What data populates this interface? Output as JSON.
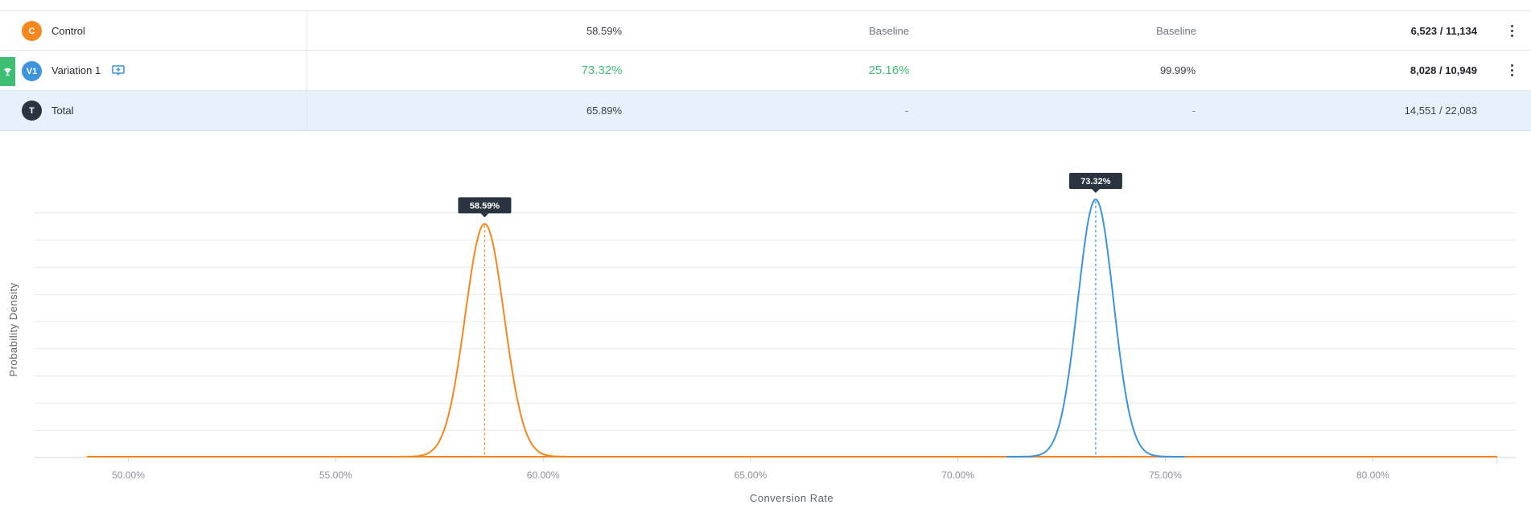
{
  "table": {
    "rows": [
      {
        "badge": "C",
        "name": "Control",
        "conversion_rate": "58.59%",
        "improvement": "Baseline",
        "probability": "Baseline",
        "conversions": "6,523 / 11,134",
        "color": "#f7861d"
      },
      {
        "badge": "V1",
        "name": "Variation 1",
        "conversion_rate": "73.32%",
        "improvement": "25.16%",
        "probability": "99.99%",
        "conversions": "8,028 / 10,949",
        "color": "#3b94dc",
        "winner": true
      },
      {
        "badge": "T",
        "name": "Total",
        "conversion_rate": "65.89%",
        "improvement": "-",
        "probability": "-",
        "conversions": "14,551 / 22,083",
        "color": "#2a3440"
      }
    ],
    "icons": {
      "winner": "trophy-icon",
      "note": "add-note-icon",
      "menu": "kebab-menu-icon"
    }
  },
  "chart_data": {
    "type": "line",
    "xlabel": "Conversion Rate",
    "ylabel": "Probability Density",
    "xlim": [
      49.0,
      83.0
    ],
    "x_ticks": [
      "50.00%",
      "55.00%",
      "60.00%",
      "65.00%",
      "70.00%",
      "75.00%",
      "80.00%"
    ],
    "x_tick_values": [
      50,
      55,
      60,
      65,
      70,
      75,
      80
    ],
    "series": [
      {
        "name": "Control",
        "color": "#f7861d",
        "mean": 58.59,
        "sd": 0.47,
        "peak_label": "58.59%",
        "relative_peak": 0.905
      },
      {
        "name": "Variation 1",
        "color": "#3b94dc",
        "mean": 73.32,
        "sd": 0.43,
        "peak_label": "73.32%",
        "relative_peak": 1.0
      }
    ],
    "grid": true
  }
}
